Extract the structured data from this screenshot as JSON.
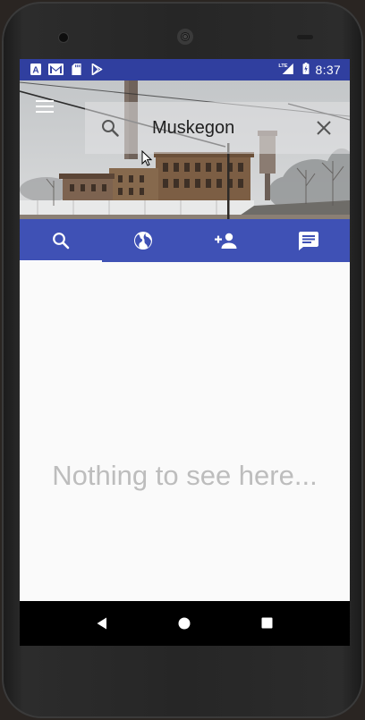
{
  "status_bar": {
    "left_icons": [
      "app-a-icon",
      "gmail-icon",
      "sd-card-icon",
      "play-store-icon"
    ],
    "network": "LTE",
    "right_icons": [
      "signal-icon",
      "battery-icon"
    ],
    "time": "8:37"
  },
  "search": {
    "query": "Muskegon",
    "menu_icon": "menu-icon",
    "search_icon": "search-icon",
    "clear_icon": "close-icon"
  },
  "tabs": [
    {
      "icon": "search-icon",
      "selected": true
    },
    {
      "icon": "globe-icon",
      "selected": false
    },
    {
      "icon": "add-person-icon",
      "selected": false
    },
    {
      "icon": "message-icon",
      "selected": false
    }
  ],
  "content": {
    "empty_message": "Nothing to see here..."
  },
  "nav_bar": {
    "buttons": [
      "back-icon",
      "home-icon",
      "recents-icon"
    ]
  },
  "colors": {
    "status_bar": "#303f9f",
    "tab_bar": "#3f51b5",
    "empty_text": "#bdbdbd",
    "background": "#fafafa"
  }
}
